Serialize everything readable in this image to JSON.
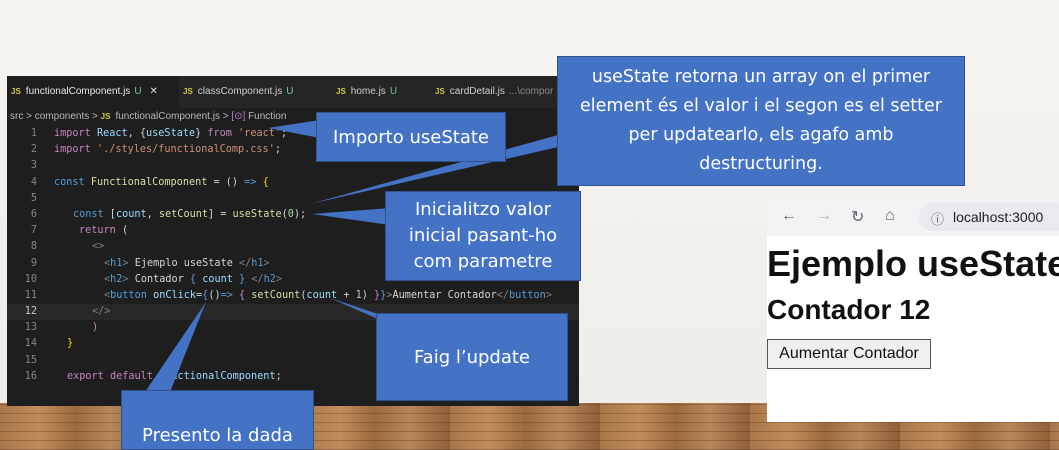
{
  "editor": {
    "tabs": [
      {
        "label": "functionalComponent.js",
        "status": "U",
        "active": true
      },
      {
        "label": "classComponent.js",
        "status": "U",
        "active": false
      },
      {
        "label": "home.js",
        "status": "U",
        "active": false
      },
      {
        "label": "cardDetail.js",
        "status": "...\\compor",
        "active": false
      }
    ],
    "breadcrumb": {
      "src": "src",
      "sep": ">",
      "components": "components",
      "file": "functionalComponent.js",
      "symbol": "Function"
    },
    "line_numbers": [
      "1",
      "2",
      "3",
      "4",
      "5",
      "6",
      "7",
      "8",
      "9",
      "10",
      "11",
      "12",
      "13",
      "14",
      "15",
      "16"
    ],
    "current_line": "12"
  },
  "browser": {
    "url": "localhost:3000",
    "h1": "Ejemplo useState",
    "h2": "Contador 12",
    "button": "Aumentar Contador"
  },
  "callouts": {
    "array": "useState retorna un array on el primer element és el valor i el segon es el setter per updatearlo, els agafo amb destructuring.",
    "import": "Importo useState",
    "init": "Inicialitzo valor inicial pasant-ho com parametre",
    "update": "Faig l’update",
    "present": "Presento la dada"
  }
}
